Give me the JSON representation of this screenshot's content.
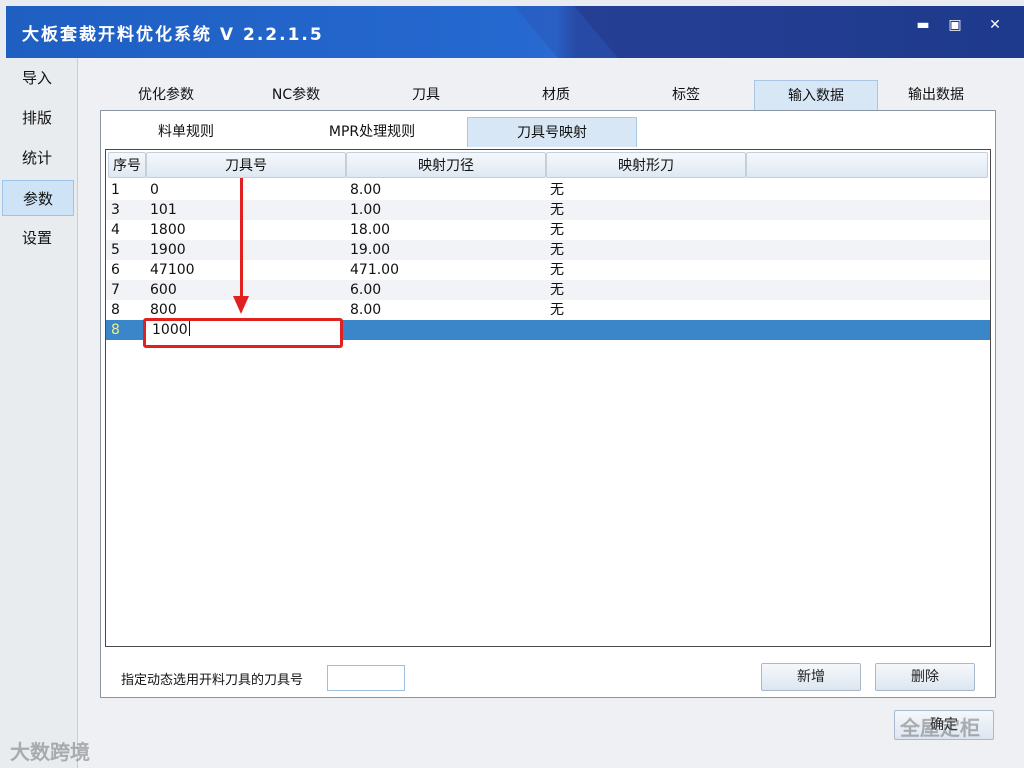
{
  "window": {
    "title": "大板套裁开料优化系统 V 2.2.1.5",
    "minimize_glyph": "▬",
    "maximize_glyph": "▣",
    "close_glyph": "✕"
  },
  "nav": {
    "items": [
      {
        "label": "导入"
      },
      {
        "label": "排版"
      },
      {
        "label": "统计"
      },
      {
        "label": "参数"
      },
      {
        "label": "设置"
      }
    ],
    "active_index": 3
  },
  "top_tabs": {
    "items": [
      {
        "label": "优化参数"
      },
      {
        "label": "NC参数"
      },
      {
        "label": "刀具"
      },
      {
        "label": "材质"
      },
      {
        "label": "标签"
      },
      {
        "label": "输入数据"
      },
      {
        "label": "输出数据"
      }
    ],
    "active_index": 5
  },
  "sub_tabs": {
    "items": [
      {
        "label": "料单规则"
      },
      {
        "label": "MPR处理规则"
      },
      {
        "label": "刀具号映射"
      }
    ],
    "active_index": 2
  },
  "grid": {
    "columns": [
      "序号",
      "刀具号",
      "映射刀径",
      "映射形刀"
    ],
    "rows": [
      {
        "seq": "1",
        "tool": "0",
        "diameter": "8.00",
        "shape": "无"
      },
      {
        "seq": "3",
        "tool": "101",
        "diameter": "1.00",
        "shape": "无"
      },
      {
        "seq": "4",
        "tool": "1800",
        "diameter": "18.00",
        "shape": "无"
      },
      {
        "seq": "5",
        "tool": "1900",
        "diameter": "19.00",
        "shape": "无"
      },
      {
        "seq": "6",
        "tool": "47100",
        "diameter": "471.00",
        "shape": "无"
      },
      {
        "seq": "7",
        "tool": "600",
        "diameter": "6.00",
        "shape": "无"
      },
      {
        "seq": "8",
        "tool": "800",
        "diameter": "8.00",
        "shape": "无"
      }
    ],
    "editing_row": {
      "seq": "8",
      "tool_value": "1000"
    }
  },
  "footer": {
    "dynamic_tool_label": "指定动态选用开料刀具的刀具号",
    "dynamic_tool_value": "",
    "add_button": "新增",
    "delete_button": "删除",
    "ok_button": "确定"
  },
  "watermarks": {
    "bottom_left": "大数跨境",
    "bottom_right": "全屋定柜"
  },
  "colors": {
    "title_bar": "#2568cf",
    "selected_row": "#3a86c8",
    "highlight": "#e1211f"
  }
}
